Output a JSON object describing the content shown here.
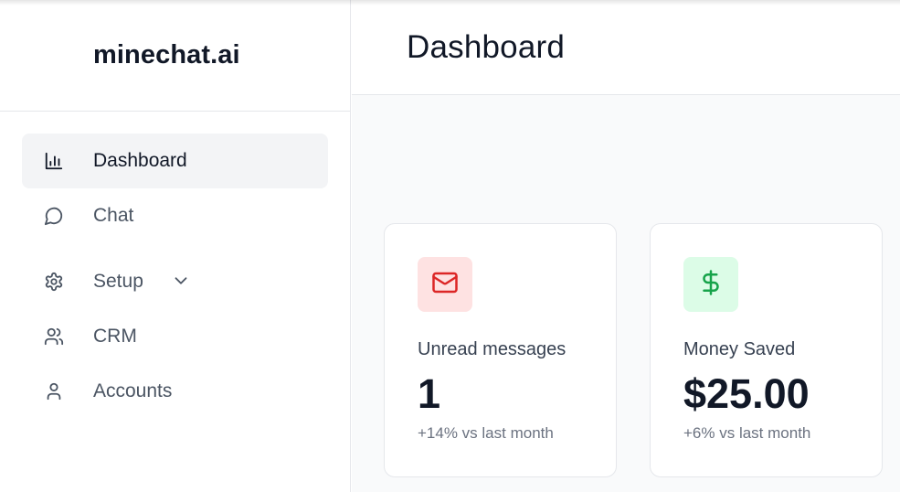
{
  "brand": {
    "name": "minechat.ai"
  },
  "sidebar": {
    "items": [
      {
        "label": "Dashboard",
        "icon": "bar-chart-icon",
        "active": true
      },
      {
        "label": "Chat",
        "icon": "message-circle-icon"
      },
      {
        "label": "Setup",
        "icon": "gear-icon",
        "has_submenu": true
      },
      {
        "label": "CRM",
        "icon": "users-icon"
      },
      {
        "label": "Accounts",
        "icon": "user-icon"
      }
    ]
  },
  "header": {
    "title": "Dashboard"
  },
  "stats": [
    {
      "label": "Unread messages",
      "value": "1",
      "delta": "+14% vs last month",
      "icon": "mail-icon",
      "icon_color": "#dc2626",
      "icon_bg": "#fee2e2"
    },
    {
      "label": "Money Saved",
      "value": "$25.00",
      "delta": "+6% vs last month",
      "icon": "dollar-icon",
      "icon_color": "#16a34a",
      "icon_bg": "#dcfce7"
    }
  ],
  "colors": {
    "text_primary": "#111827",
    "text_muted": "#6b7280",
    "active_bg": "#f3f4f6",
    "main_bg": "#f9fafb"
  }
}
